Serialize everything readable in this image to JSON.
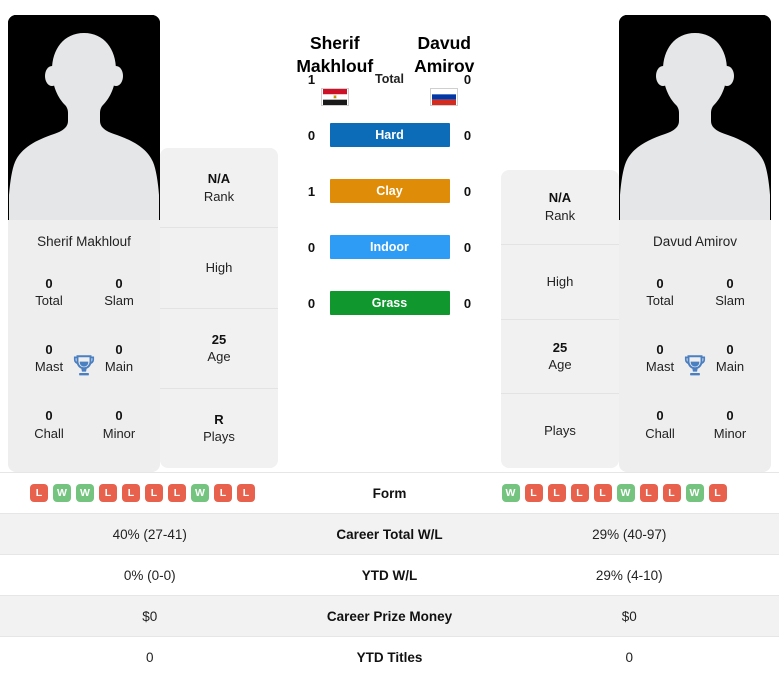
{
  "players": {
    "left": {
      "first_name": "Sherif",
      "last_name": "Makhlouf",
      "full_name": "Sherif Makhlouf",
      "country": "Egypt",
      "flag_icon": "flag-egypt",
      "titles": {
        "total": "0",
        "total_label": "Total",
        "slam": "0",
        "slam_label": "Slam",
        "mast": "0",
        "mast_label": "Mast",
        "main": "0",
        "main_label": "Main",
        "chall": "0",
        "chall_label": "Chall",
        "minor": "0",
        "minor_label": "Minor"
      },
      "info": {
        "rank_value": "N/A",
        "rank_label": "Rank",
        "high_value": "",
        "high_label": "High",
        "age_value": "25",
        "age_label": "Age",
        "plays_value": "R",
        "plays_label": "Plays"
      }
    },
    "right": {
      "first_name": "Davud",
      "last_name": "Amirov",
      "full_name": "Davud Amirov",
      "country": "Russia",
      "flag_icon": "flag-russia",
      "titles": {
        "total": "0",
        "total_label": "Total",
        "slam": "0",
        "slam_label": "Slam",
        "mast": "0",
        "mast_label": "Mast",
        "main": "0",
        "main_label": "Main",
        "chall": "0",
        "chall_label": "Chall",
        "minor": "0",
        "minor_label": "Minor"
      },
      "info": {
        "rank_value": "N/A",
        "rank_label": "Rank",
        "high_value": "",
        "high_label": "High",
        "age_value": "25",
        "age_label": "Age",
        "plays_value": "",
        "plays_label": "Plays"
      }
    }
  },
  "head_to_head": {
    "rows": [
      {
        "label": "Total",
        "left": "1",
        "right": "0",
        "style": "plain",
        "color": ""
      },
      {
        "label": "Hard",
        "left": "0",
        "right": "0",
        "style": "badge",
        "color": "#0c6cb8"
      },
      {
        "label": "Clay",
        "left": "1",
        "right": "0",
        "style": "badge",
        "color": "#df8d09"
      },
      {
        "label": "Indoor",
        "left": "0",
        "right": "0",
        "style": "badge",
        "color": "#2e9bf5"
      },
      {
        "label": "Grass",
        "left": "0",
        "right": "0",
        "style": "badge",
        "color": "#10982f"
      }
    ]
  },
  "stats": {
    "form": {
      "label": "Form",
      "left": [
        "L",
        "W",
        "W",
        "L",
        "L",
        "L",
        "L",
        "W",
        "L",
        "L"
      ],
      "right": [
        "W",
        "L",
        "L",
        "L",
        "L",
        "W",
        "L",
        "L",
        "W",
        "L"
      ]
    },
    "rows": [
      {
        "label": "Career Total W/L",
        "left": "40% (27-41)",
        "right": "29% (40-97)"
      },
      {
        "label": "YTD W/L",
        "left": "0% (0-0)",
        "right": "29% (4-10)"
      },
      {
        "label": "Career Prize Money",
        "left": "$0",
        "right": "$0"
      },
      {
        "label": "YTD Titles",
        "left": "0",
        "right": "0"
      }
    ]
  },
  "colors": {
    "win": "#74c480",
    "loss": "#e8614c",
    "hard": "#0c6cb8",
    "clay": "#df8d09",
    "indoor": "#2e9bf5",
    "grass": "#10982f",
    "trophy": "#4a7fc1"
  }
}
